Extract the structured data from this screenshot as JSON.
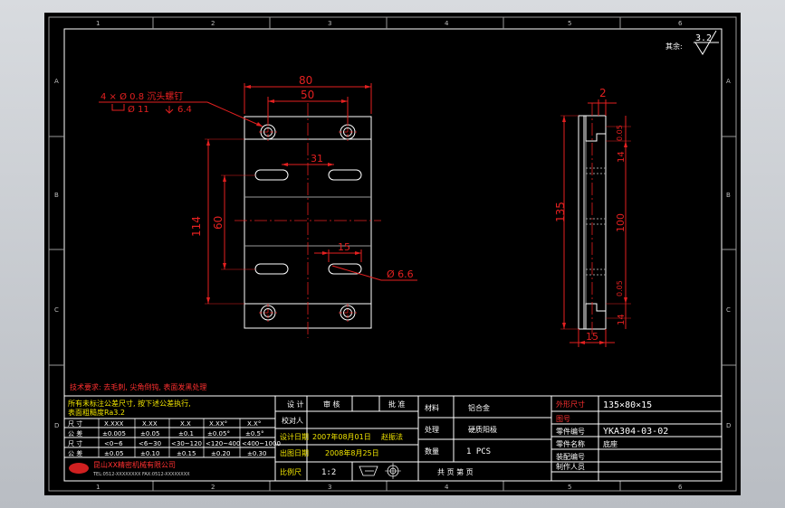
{
  "border": {
    "columns": [
      "1",
      "2",
      "3",
      "4",
      "5",
      "6"
    ],
    "rows": [
      "A",
      "B",
      "C",
      "D"
    ]
  },
  "surface": {
    "label": "其余:",
    "value": "3.2"
  },
  "front_view": {
    "dim_overall_width": "80",
    "dim_hole_spacing": "50",
    "dim_slot_spacing": "31",
    "dim_slot_length": "15",
    "dim_overall_height": "114",
    "dim_hole_vertical": "60",
    "hole_note_line1": "4 × Ø 0.8 沉头螺钉",
    "hole_note_dia": "Ø 11",
    "hole_note_depth": "6.4",
    "slot_dia": "Ø 6.6"
  },
  "side_view": {
    "dim_top": "2",
    "dim_total_height": "135",
    "dim_inner": "100",
    "dim_upper_small": "0.05",
    "dim_upper_14": "14",
    "dim_lower_small": "0.05",
    "dim_lower_14": "14",
    "dim_thickness": "15"
  },
  "notes": {
    "tech_req": "技术要求: 去毛刺, 尖角倒钝, 表面发黑处理",
    "tolerance_line1": "所有未标注公差尺寸, 按下述公差执行,",
    "tolerance_line2": "表面粗糙度Ra3.2"
  },
  "tolerance_table": {
    "headers": [
      "尺 寸",
      "X.XXX",
      "X.XX",
      "X.X",
      "X.XX°",
      "X.X°"
    ],
    "rows": [
      [
        "公 差",
        "±0.005",
        "±0.05",
        "±0.1",
        "±0.05°",
        "±0.5°"
      ],
      [
        "尺 寸",
        "<0~6",
        "<6~30",
        "<30~120",
        "<120~400",
        "<400~1000"
      ],
      [
        "公 差",
        "±0.05",
        "±0.10",
        "±0.15",
        "±0.20",
        "±0.30"
      ]
    ],
    "company": "昆山XX精密机械有限公司",
    "company_sub": "TEL:0512-XXXXXXXX FAX:0512-XXXXXXXX"
  },
  "title_block": {
    "design": "设 计",
    "review": "审 核",
    "approve": "批 准",
    "check": "校对人",
    "design_date_label": "设计日期",
    "design_date": "2007年08月01日",
    "designer": "赵振法",
    "issue_date_label": "出图日期",
    "issue_date": "2008年8月25日",
    "scale_label": "比例尺",
    "scale": "1:2",
    "material_label": "材料",
    "material": "铝合金",
    "heat_label": "处理",
    "heat": "硬质阳极",
    "qty_label": "数量",
    "qty": "1 PCS",
    "sheet_label": "共 页 第 页",
    "size_label": "外形尺寸",
    "size": "135×80×15",
    "drawing_no_label": "图号",
    "part_no_label": "零件编号",
    "part_no": "YKA304-03-02",
    "part_name_label": "零件名称",
    "part_name": "底座",
    "assembly_label": "装配编号",
    "drafter_label": "制作人员"
  }
}
